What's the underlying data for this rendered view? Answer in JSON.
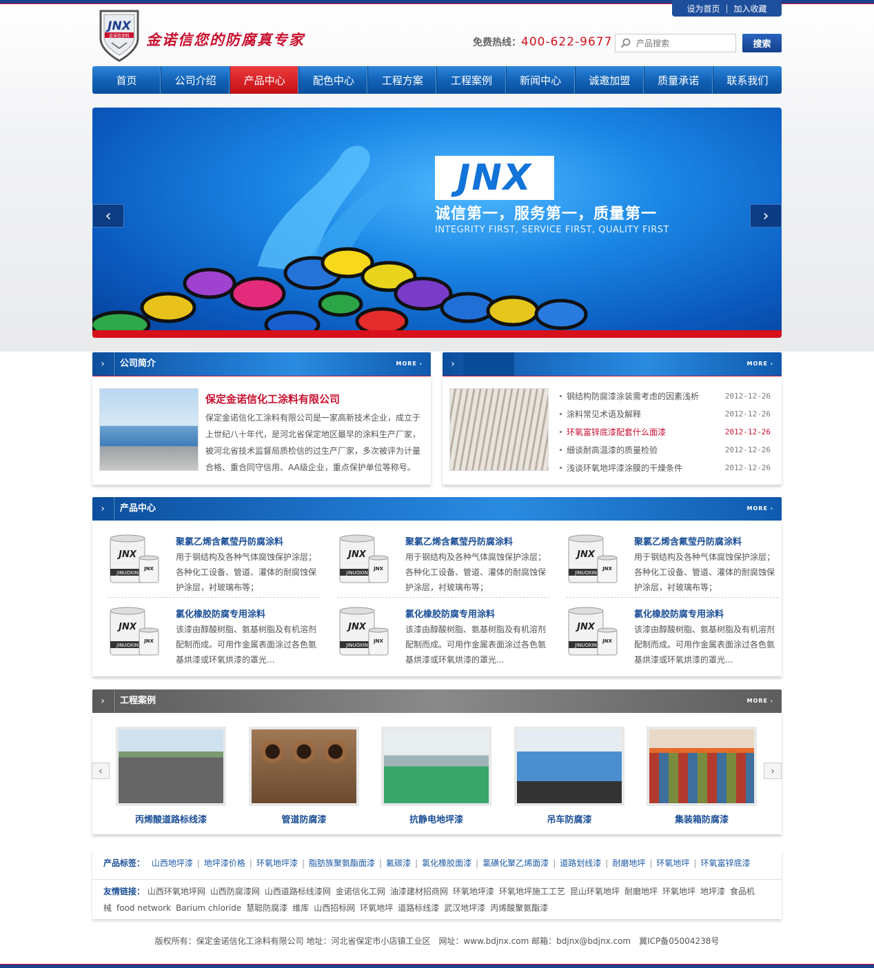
{
  "header": {
    "top_links": [
      "设为首页",
      "加入收藏"
    ],
    "logo_text": "JNX",
    "logo_sub": "金诺信涂料",
    "slogan": "金诺信您的防腐真专家",
    "hotline_label": "免费热线：",
    "hotline_number": "400-622-9677",
    "search_placeholder": "产品搜索",
    "search_button": "搜索"
  },
  "nav": {
    "items": [
      "首页",
      "公司介绍",
      "产品中心",
      "配色中心",
      "工程方案",
      "工程案例",
      "新闻中心",
      "诚邀加盟",
      "质量承诺",
      "联系我们"
    ],
    "active": "产品中心"
  },
  "banner": {
    "brand": "JNX",
    "slogan_cn": "诚信第一，服务第一，质量第一",
    "slogan_en": "INTEGRITY FIRST, SERVICE FIRST, QUALITY FIRST",
    "prev_icon": "chevron-left-icon",
    "next_icon": "chevron-right-icon"
  },
  "company": {
    "section_title": "公司简介",
    "more": "MORE",
    "name": "保定金诺信化工涂料有限公司",
    "intro": "保定金诺信化工涂料有限公司是一家高新技术企业，成立于上世纪八十年代，是河北省保定地区最早的涂料生产厂家，被河北省技术监督局质检信的过生产厂家，多次被评为计量合格、重合同守信用、AA级企业，重点保护单位等称号。"
  },
  "news": {
    "more": "MORE",
    "items": [
      {
        "title": "钢结构防腐漆涂装需考虑的因素浅析",
        "date": "2012-12-26"
      },
      {
        "title": "涂料常见术语及解释",
        "date": "2012-12-26"
      },
      {
        "title": "环氧富锌底漆配套什么面漆",
        "date": "2012-12-26"
      },
      {
        "title": "细谈耐高温漆的质量检验",
        "date": "2012-12-26"
      },
      {
        "title": "浅谈环氧地坪漆涂膜的干燥条件",
        "date": "2012-12-26"
      }
    ]
  },
  "products": {
    "section_title": "产品中心",
    "more": "MORE",
    "can_brand": "JNX",
    "can_sub": "JINUOXIN",
    "items": [
      {
        "name": "聚氯乙烯含氟莹丹防腐涂料",
        "desc": "用于钢结构及各种气体腐蚀保护涂层；各种化工设备、管道、灌体的耐腐蚀保护涂层，衬玻璃布等；"
      },
      {
        "name": "聚氯乙烯含氟莹丹防腐涂料",
        "desc": "用于钢结构及各种气体腐蚀保护涂层；各种化工设备、管道、灌体的耐腐蚀保护涂层，衬玻璃布等；"
      },
      {
        "name": "聚氯乙烯含氟莹丹防腐涂料",
        "desc": "用于钢结构及各种气体腐蚀保护涂层；各种化工设备、管道、灌体的耐腐蚀保护涂层，衬玻璃布等；"
      },
      {
        "name": "氯化橡胶防腐专用涂料",
        "desc": "该漆由醇酸树脂、氨基树脂及有机溶剂配制而成。可用作金属表面涂过各色氨基烘漆或环氧烘漆的罩光..."
      },
      {
        "name": "氯化橡胶防腐专用涂料",
        "desc": "该漆由醇酸树脂、氨基树脂及有机溶剂配制而成。可用作金属表面涂过各色氨基烘漆或环氧烘漆的罩光..."
      },
      {
        "name": "氯化橡胶防腐专用涂料",
        "desc": "该漆由醇酸树脂、氨基树脂及有机溶剂配制而成。可用作金属表面涂过各色氨基烘漆或环氧烘漆的罩光..."
      }
    ]
  },
  "cases": {
    "section_title": "工程案例",
    "more": "MORE",
    "items": [
      "丙烯酸道路标线漆",
      "管道防腐漆",
      "抗静电地坪漆",
      "吊车防腐漆",
      "集装箱防腐漆"
    ]
  },
  "tags": {
    "label": "产品标签：",
    "items": [
      "山西地坪漆",
      "地坪漆价格",
      "环氧地坪漆",
      "脂肪族聚氨酯面漆",
      "氟碳漆",
      "氯化橡胶面漆",
      "氯磺化聚乙烯面漆",
      "道路划线漆",
      "耐磨地坪",
      "环氧地坪",
      "环氧富锌底漆"
    ]
  },
  "links": {
    "label": "友情链接：",
    "items": [
      "山西环氧地坪网",
      "山西防腐漆网",
      "山西道路标线漆网",
      "金诺信化工网",
      "油漆建材招商网",
      "环氧地坪漆",
      "环氧地坪施工工艺",
      "昆山环氧地坪",
      "耐磨地坪",
      "环氧地坪",
      "地坪漆",
      "食品机械",
      "food network",
      "Barium chloride",
      "慧聪防腐漆",
      "维库",
      "山西招标网",
      "环氧地坪",
      "道路标线漆",
      "武汉地坪漆",
      "丙烯酸聚氨酯漆"
    ]
  },
  "footer": {
    "text": "版权所有：保定金诺信化工涂料有限公司 地址：河北省保定市小店镇工业区　网址：www.bdjnx.com 邮箱：bdjnx@bdjnx.com　冀ICP备05004238号"
  }
}
